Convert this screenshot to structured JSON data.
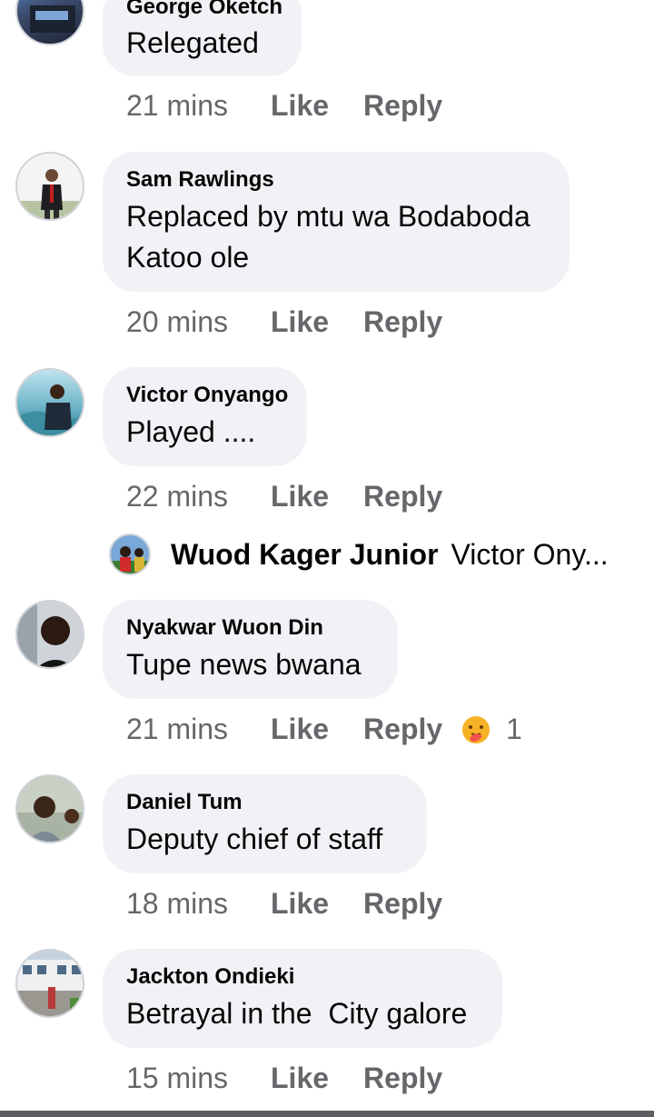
{
  "comments": [
    {
      "author": "George Oketch",
      "text": "Relegated",
      "time": "21 mins",
      "like": "Like",
      "reply": "Reply"
    },
    {
      "author": "Sam Rawlings",
      "text_lines": [
        "Replaced by mtu wa Bodaboda",
        "Katoo ole"
      ],
      "time": "20 mins",
      "like": "Like",
      "reply": "Reply"
    },
    {
      "author": "Victor Onyango",
      "text": "Played ....",
      "time": "22 mins",
      "like": "Like",
      "reply": "Reply"
    },
    {
      "author": "Nyakwar Wuon Din",
      "text": "Tupe news bwana",
      "time": "21 mins",
      "like": "Like",
      "reply": "Reply",
      "reaction_count": "1",
      "reaction_icon": "care-reaction-icon"
    },
    {
      "author": "Daniel Tum",
      "text": "Deputy chief of staff",
      "time": "18 mins",
      "like": "Like",
      "reply": "Reply"
    },
    {
      "author": "Jackton Ondieki",
      "text": "Betrayal in the  City galore",
      "time": "15 mins",
      "like": "Like",
      "reply": "Reply"
    }
  ],
  "reply_preview": {
    "author": "Wuod Kager Junior",
    "text": "Victor Ony..."
  },
  "colors": {
    "bubble": "#f0f2f5",
    "meta": "#65676b",
    "text": "#050505"
  }
}
